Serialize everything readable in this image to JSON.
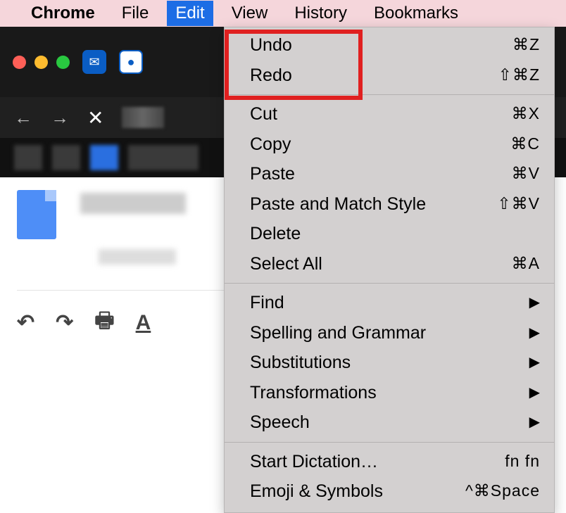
{
  "menubar": {
    "app": "Chrome",
    "items": [
      "File",
      "Edit",
      "View",
      "History",
      "Bookmarks"
    ],
    "active": "Edit"
  },
  "dropdown": {
    "groups": [
      [
        {
          "label": "Undo",
          "shortcut": "⌘Z"
        },
        {
          "label": "Redo",
          "shortcut": "⇧⌘Z"
        }
      ],
      [
        {
          "label": "Cut",
          "shortcut": "⌘X"
        },
        {
          "label": "Copy",
          "shortcut": "⌘C"
        },
        {
          "label": "Paste",
          "shortcut": "⌘V"
        },
        {
          "label": "Paste and Match Style",
          "shortcut": "⇧⌘V"
        },
        {
          "label": "Delete",
          "shortcut": ""
        },
        {
          "label": "Select All",
          "shortcut": "⌘A"
        }
      ],
      [
        {
          "label": "Find",
          "submenu": true
        },
        {
          "label": "Spelling and Grammar",
          "submenu": true
        },
        {
          "label": "Substitutions",
          "submenu": true
        },
        {
          "label": "Transformations",
          "submenu": true
        },
        {
          "label": "Speech",
          "submenu": true
        }
      ],
      [
        {
          "label": "Start Dictation…",
          "shortcut": "fn fn"
        },
        {
          "label": "Emoji & Symbols",
          "shortcut": "^⌘Space"
        }
      ]
    ]
  },
  "toolbar": {
    "undo_icon": "↶",
    "redo_icon": "↷",
    "print_icon": "🖶",
    "spell_icon": "A"
  }
}
